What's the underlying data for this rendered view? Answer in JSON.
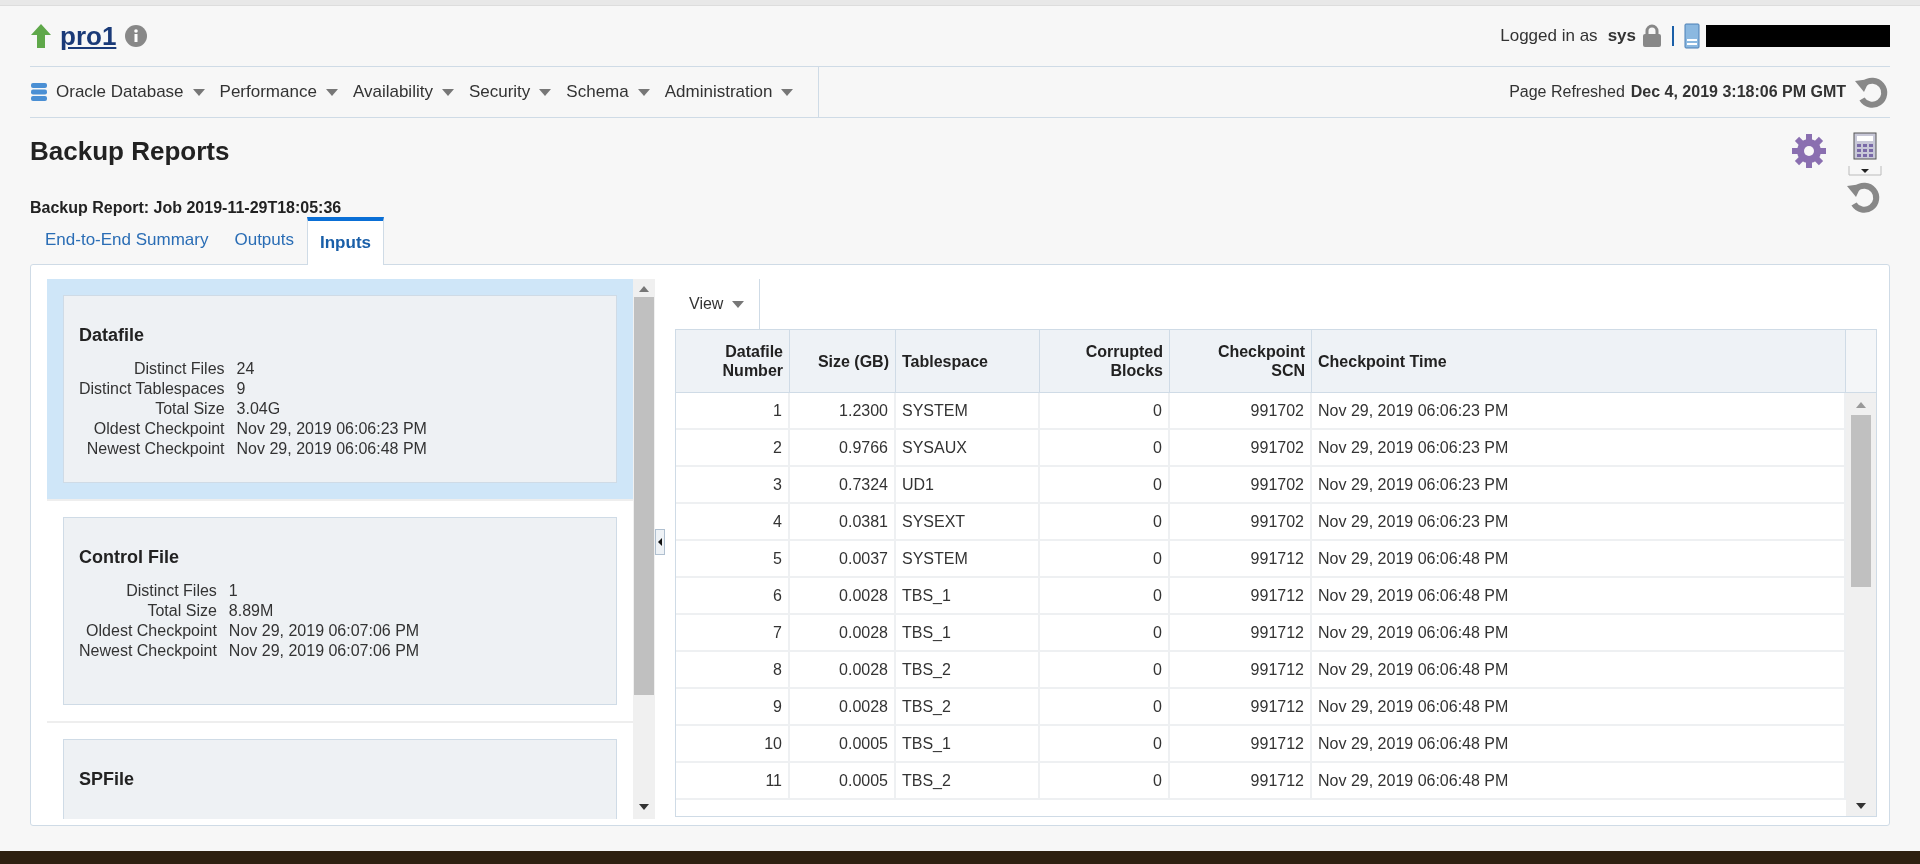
{
  "target": {
    "name": "pro1"
  },
  "user_info": {
    "label": "Logged in as",
    "user": "sys"
  },
  "menu": [
    {
      "label": "Oracle Database"
    },
    {
      "label": "Performance"
    },
    {
      "label": "Availability"
    },
    {
      "label": "Security"
    },
    {
      "label": "Schema"
    },
    {
      "label": "Administration"
    }
  ],
  "refresh": {
    "label": "Page Refreshed",
    "time": "Dec 4, 2019 3:18:06 PM GMT"
  },
  "page_title": "Backup Reports",
  "subtitle": "Backup Report: Job 2019-11-29T18:05:36",
  "tabs": [
    {
      "label": "End-to-End Summary",
      "selected": false
    },
    {
      "label": "Outputs",
      "selected": false
    },
    {
      "label": "Inputs",
      "selected": true
    }
  ],
  "input_cards": [
    {
      "title": "Datafile",
      "selected": true,
      "fields": [
        {
          "label": "Distinct Files",
          "value": "24"
        },
        {
          "label": "Distinct Tablespaces",
          "value": "9"
        },
        {
          "label": "Total Size",
          "value": "3.04G"
        },
        {
          "label": "Oldest Checkpoint",
          "value": "Nov 29, 2019 06:06:23 PM"
        },
        {
          "label": "Newest Checkpoint",
          "value": "Nov 29, 2019 06:06:48 PM"
        }
      ]
    },
    {
      "title": "Control File",
      "selected": false,
      "fields": [
        {
          "label": "Distinct Files",
          "value": "1"
        },
        {
          "label": "Total Size",
          "value": "8.89M"
        },
        {
          "label": "Oldest Checkpoint",
          "value": "Nov 29, 2019 06:07:06 PM"
        },
        {
          "label": "Newest Checkpoint",
          "value": "Nov 29, 2019 06:07:06 PM"
        }
      ]
    },
    {
      "title": "SPFile",
      "selected": false
    }
  ],
  "view_menu": "View",
  "table": {
    "columns": [
      "Datafile Number",
      "Size (GB)",
      "Tablespace",
      "Corrupted Blocks",
      "Checkpoint SCN",
      "Checkpoint Time"
    ],
    "rows": [
      [
        "1",
        "1.2300",
        "SYSTEM",
        "0",
        "991702",
        "Nov 29, 2019 06:06:23 PM"
      ],
      [
        "2",
        "0.9766",
        "SYSAUX",
        "0",
        "991702",
        "Nov 29, 2019 06:06:23 PM"
      ],
      [
        "3",
        "0.7324",
        "UD1",
        "0",
        "991702",
        "Nov 29, 2019 06:06:23 PM"
      ],
      [
        "4",
        "0.0381",
        "SYSEXT",
        "0",
        "991702",
        "Nov 29, 2019 06:06:23 PM"
      ],
      [
        "5",
        "0.0037",
        "SYSTEM",
        "0",
        "991712",
        "Nov 29, 2019 06:06:48 PM"
      ],
      [
        "6",
        "0.0028",
        "TBS_1",
        "0",
        "991712",
        "Nov 29, 2019 06:06:48 PM"
      ],
      [
        "7",
        "0.0028",
        "TBS_1",
        "0",
        "991712",
        "Nov 29, 2019 06:06:48 PM"
      ],
      [
        "8",
        "0.0028",
        "TBS_2",
        "0",
        "991712",
        "Nov 29, 2019 06:06:48 PM"
      ],
      [
        "9",
        "0.0028",
        "TBS_2",
        "0",
        "991712",
        "Nov 29, 2019 06:06:48 PM"
      ],
      [
        "10",
        "0.0005",
        "TBS_1",
        "0",
        "991712",
        "Nov 29, 2019 06:06:48 PM"
      ],
      [
        "11",
        "0.0005",
        "TBS_2",
        "0",
        "991712",
        "Nov 29, 2019 06:06:48 PM"
      ]
    ]
  }
}
